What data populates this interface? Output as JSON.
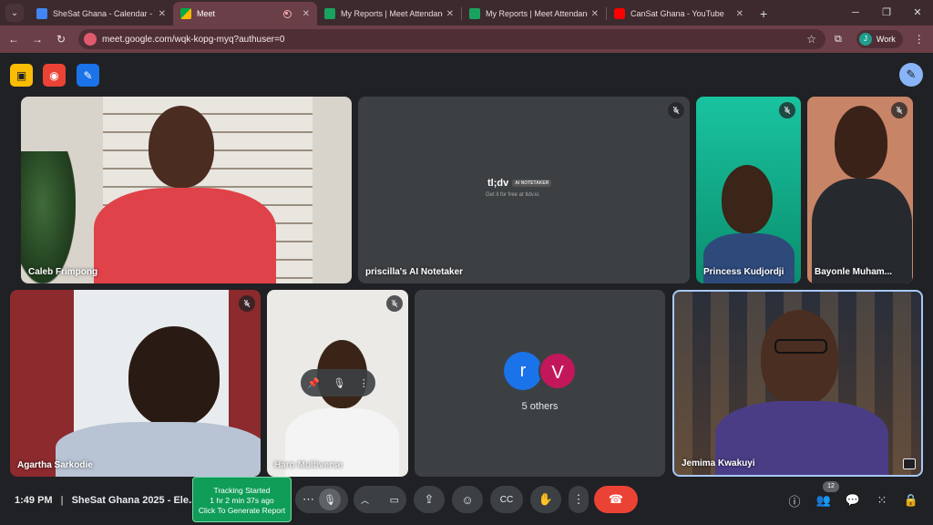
{
  "browser": {
    "tabs": [
      {
        "title": "SheSat Ghana - Calendar - Wee",
        "favicon_color": "#4285f4"
      },
      {
        "title": "Meet",
        "favicon_color": "#00ac47"
      },
      {
        "title": "My Reports | Meet Attendance",
        "favicon_color": "#1aa260"
      },
      {
        "title": "My Reports | Meet Attendance",
        "favicon_color": "#1aa260"
      },
      {
        "title": "CanSat Ghana - YouTube",
        "favicon_color": "#ff0000"
      }
    ],
    "active_tab_index": 1,
    "new_tab": "+",
    "url": "meet.google.com/wqk-kopg-myq?authuser=0",
    "profile_initial": "J",
    "profile_label": "Work"
  },
  "participants": [
    {
      "name": "Caleb Frimpong"
    },
    {
      "name": "priscilla's AI Notetaker"
    },
    {
      "name": "Princess Kudjordji"
    },
    {
      "name": "Bayonle Muham..."
    },
    {
      "name": "Agartha Sarkodie"
    },
    {
      "name": "Haro Multiverse"
    },
    {
      "name": "Jemima Kwakuyi"
    }
  ],
  "notetaker": {
    "logo": "tl;dv",
    "badge": "AI NOTETAKER",
    "subtitle": "Get it for free at tldv.io"
  },
  "others": {
    "avatars": [
      {
        "letter": "r",
        "color": "#1a73e8"
      },
      {
        "letter": "V",
        "color": "#c2185b"
      }
    ],
    "label": "5 others"
  },
  "meeting": {
    "time": "1:49 PM",
    "title": "SheSat Ghana 2025 - Ele...",
    "separator": "|"
  },
  "tracking": {
    "line1": "Tracking Started",
    "line2": "1 hr 2 min 37s ago",
    "line3": "Click To Generate Report"
  },
  "people_count": "12",
  "colors": {
    "tab_strip": "#3c2a2e",
    "address_bar": "#6b3f47",
    "meet_bg": "#202124",
    "end_call": "#ea4335",
    "tracking": "#0f9d58"
  }
}
